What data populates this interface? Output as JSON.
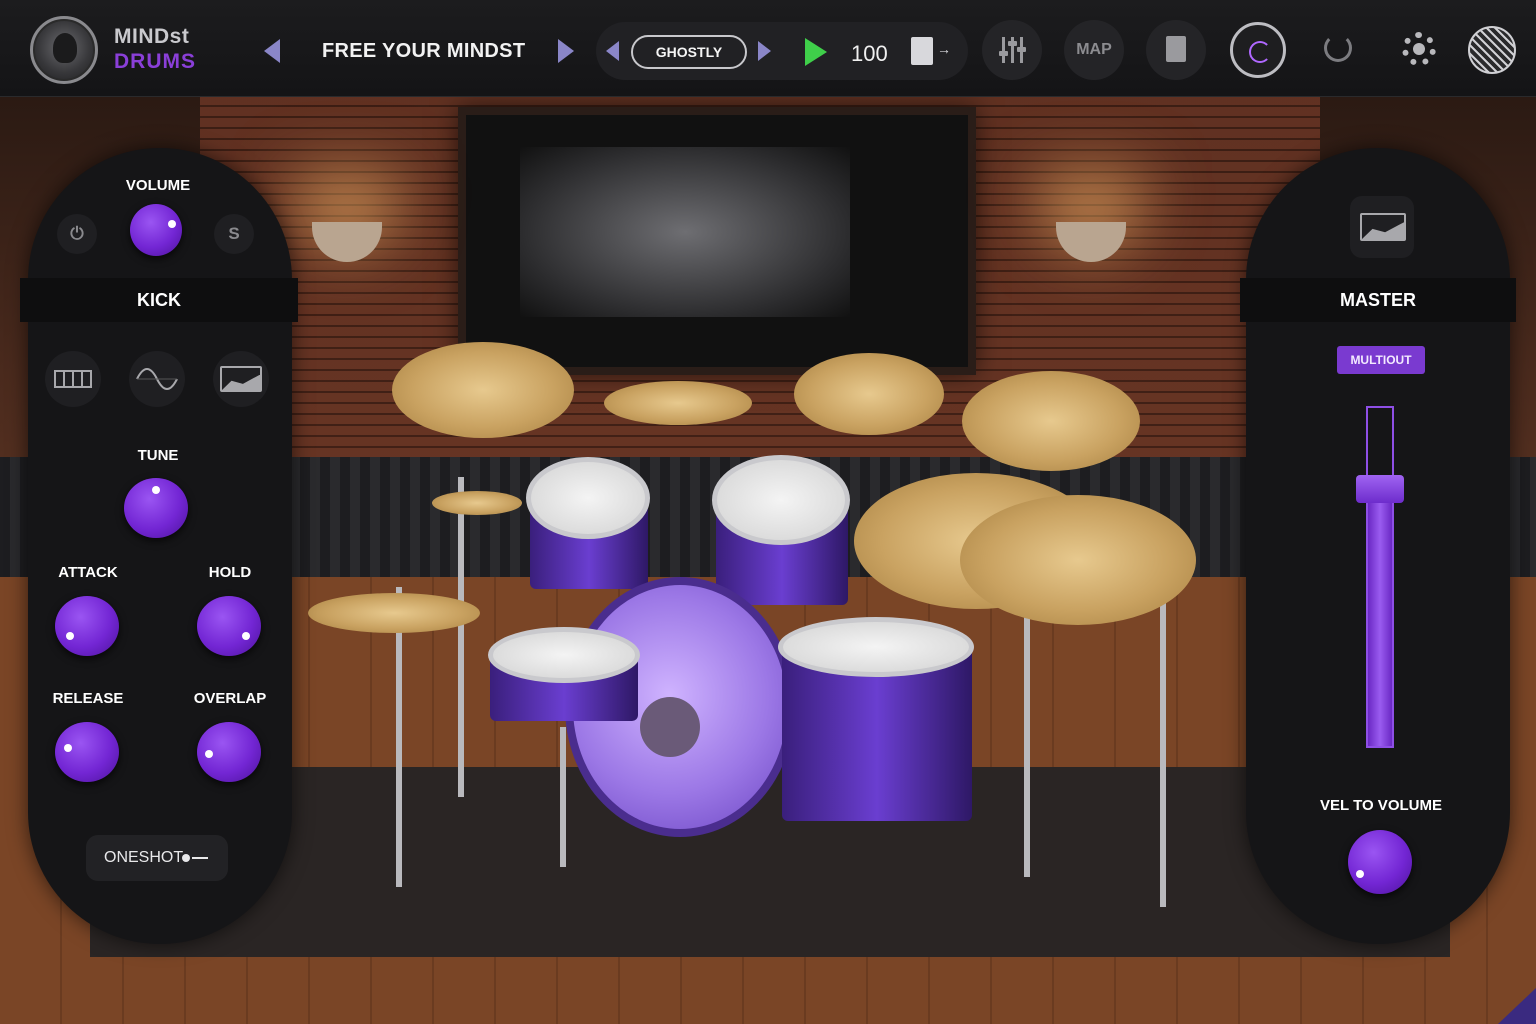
{
  "app": {
    "logo_line1": "MINDst",
    "logo_line2": "DRUMS"
  },
  "toolbar": {
    "preset_name": "FREE YOUR MINDST",
    "pattern_name": "GHOSTLY",
    "tempo": "100",
    "map_label": "MAP"
  },
  "left_panel": {
    "volume_label": "VOLUME",
    "solo_label": "S",
    "instrument_name": "KICK",
    "tune_label": "TUNE",
    "attack_label": "ATTACK",
    "hold_label": "HOLD",
    "release_label": "RELEASE",
    "overlap_label": "OVERLAP",
    "oneshot_label": "ONESHOT"
  },
  "right_panel": {
    "section_name": "MASTER",
    "multiout_label": "MULTIOUT",
    "vel_to_volume_label": "VEL TO VOLUME",
    "fader_level": 0.76
  },
  "colors": {
    "accent": "#7a3ad0",
    "knob": "#7326d4",
    "play": "#3fcf4a",
    "nav_arrow": "#8a86c8",
    "logo_purple": "#8a3fd8"
  },
  "icons": {
    "power": "power-icon",
    "keyboard": "piano-keys-icon",
    "wave": "sine-wave-icon",
    "envelope": "envelope-graph-icon",
    "settings": "gear-icon",
    "undo": "undo-icon",
    "redo": "redo-icon"
  }
}
